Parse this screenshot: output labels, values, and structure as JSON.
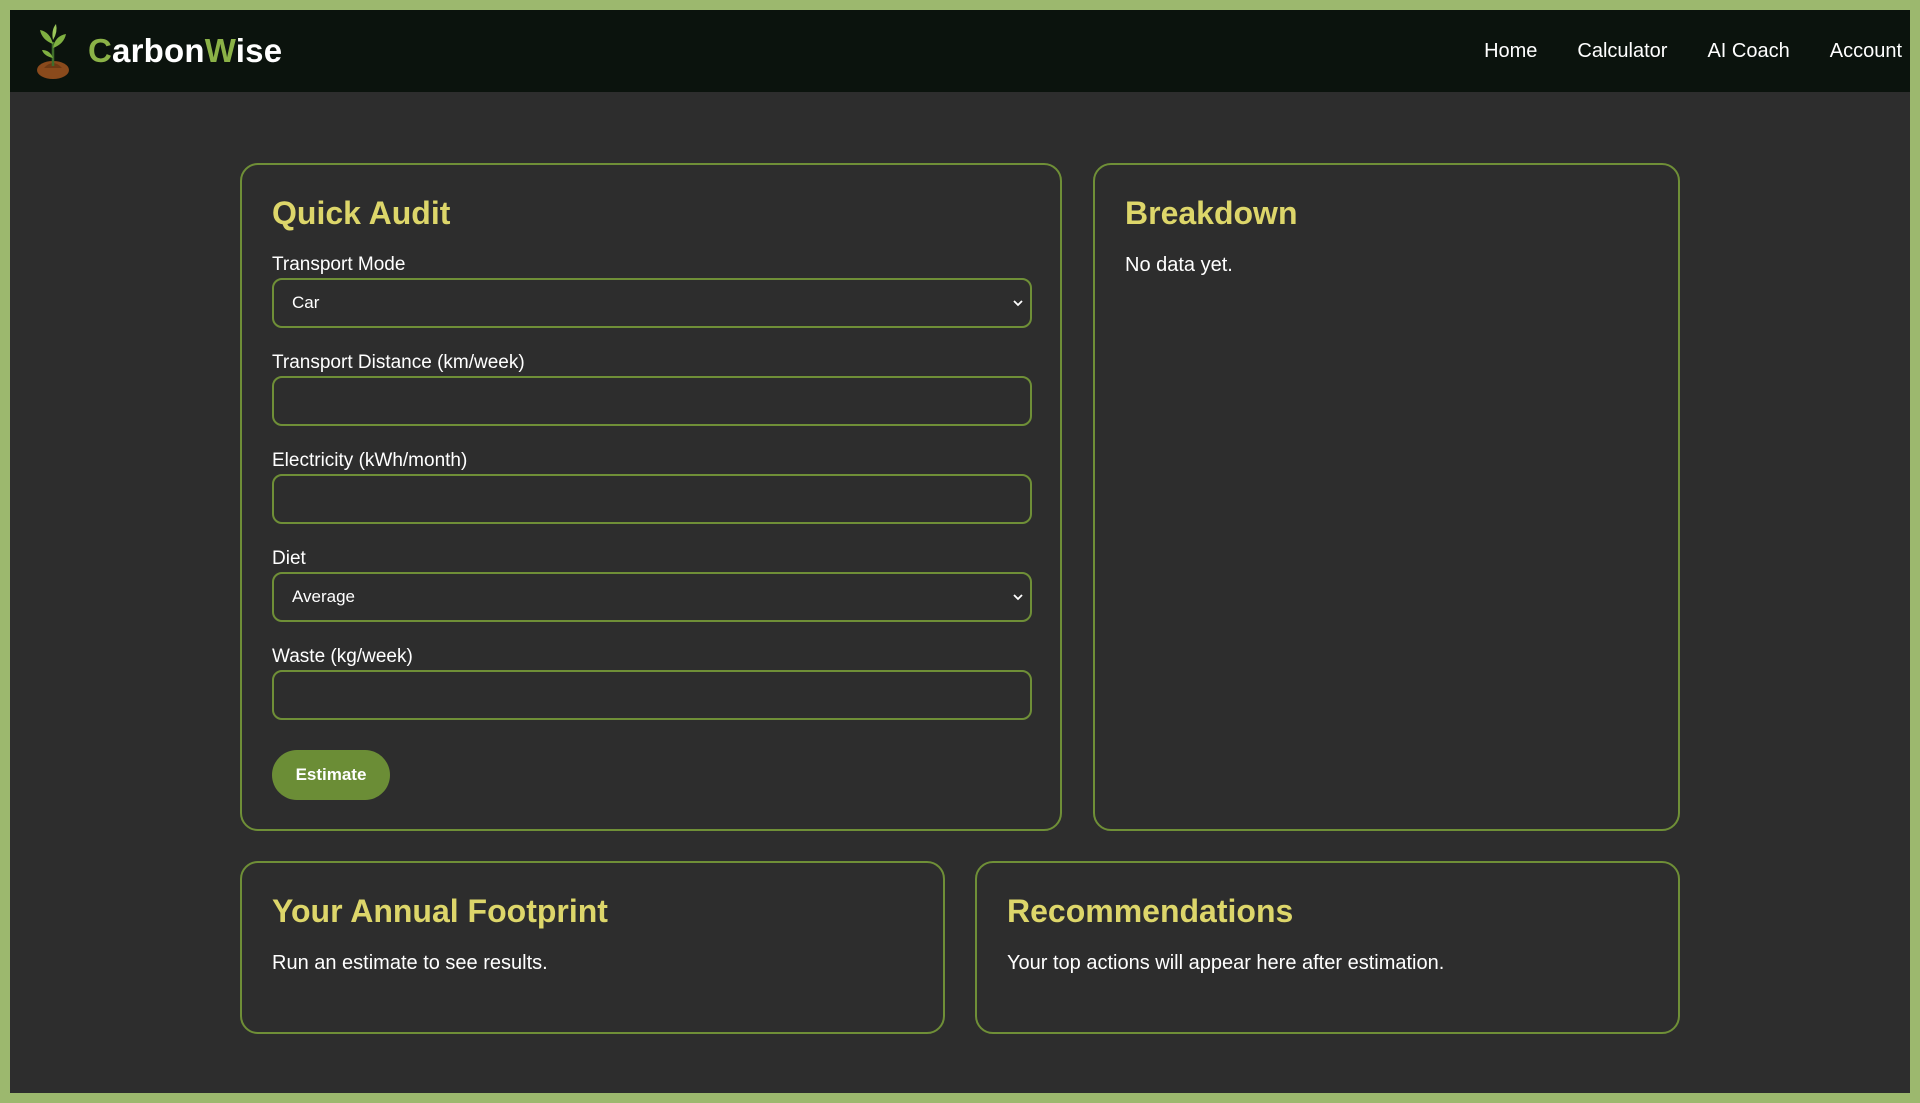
{
  "brand": {
    "name_first_letter": "C",
    "name_part1": "arbon",
    "name_second_letter": "W",
    "name_part2": "ise",
    "accent_color": "#8bb247"
  },
  "nav": {
    "items": [
      {
        "label": "Home"
      },
      {
        "label": "Calculator"
      },
      {
        "label": "AI Coach"
      },
      {
        "label": "Account"
      }
    ]
  },
  "audit": {
    "title": "Quick Audit",
    "transport_mode": {
      "label": "Transport Mode",
      "value": "Car"
    },
    "transport_distance": {
      "label": "Transport Distance (km/week)",
      "value": ""
    },
    "electricity": {
      "label": "Electricity (kWh/month)",
      "value": ""
    },
    "diet": {
      "label": "Diet",
      "value": "Average"
    },
    "waste": {
      "label": "Waste (kg/week)",
      "value": ""
    },
    "estimate_button": "Estimate"
  },
  "breakdown": {
    "title": "Breakdown",
    "empty_text": "No data yet."
  },
  "footprint": {
    "title": "Your Annual Footprint",
    "text": "Run an estimate to see results."
  },
  "recommendations": {
    "title": "Recommendations",
    "text": "Your top actions will appear here after estimation."
  },
  "colors": {
    "page_border": "#9cb86e",
    "background": "#2d2d2d",
    "navbar": "#0b130d",
    "heading": "#ddd66a",
    "card_border": "#6f8f37",
    "button": "#6b8d36"
  }
}
